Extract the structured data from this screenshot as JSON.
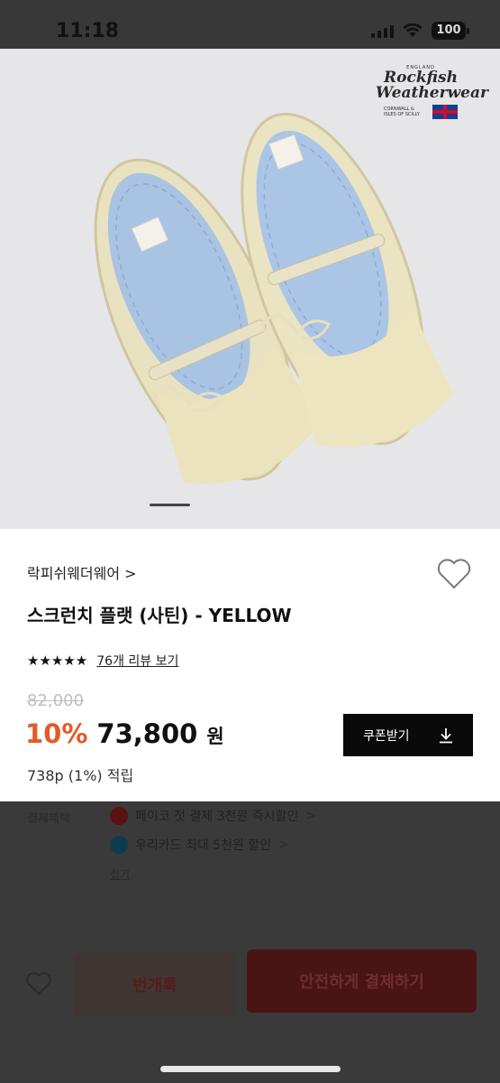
{
  "status_bar": {
    "time": "11:18",
    "battery": "100"
  },
  "product_image": {
    "logo_small": "ENGLAND",
    "logo_line1": "Rockfish",
    "logo_line2": "Weatherwear",
    "logo_sub": "CORNWALL & ISLES OF SCILLY",
    "page_indicator": "1"
  },
  "product": {
    "brand": "락피쉬웨더웨어",
    "brand_chevron": ">",
    "title": "스크런치 플랫 (사틴) - YELLOW",
    "stars": "★★★★★",
    "review_link": "76개 리뷰 보기",
    "original_price": "82,000",
    "discount": "10%",
    "price": "73,800",
    "currency": "원",
    "points": "738p (1%) 적립",
    "coupon_label": "쿠폰받기"
  },
  "payment_benefits": {
    "label": "결제혜택",
    "items": [
      {
        "text": "페이코 첫 결제 3천원 즉시할인",
        "chevron": ">",
        "color": "#5a1212"
      },
      {
        "text": "우리카드 최대 5천원 할인",
        "chevron": ">",
        "color": "#0e3a52"
      }
    ],
    "fold_label": "접기"
  },
  "bottom_bar": {
    "chat_label": "번개톡",
    "pay_label": "안전하게 결제하기"
  },
  "icons": {
    "heart": "heart-icon",
    "download": "download-icon",
    "chevron": "chevron-right-icon"
  }
}
